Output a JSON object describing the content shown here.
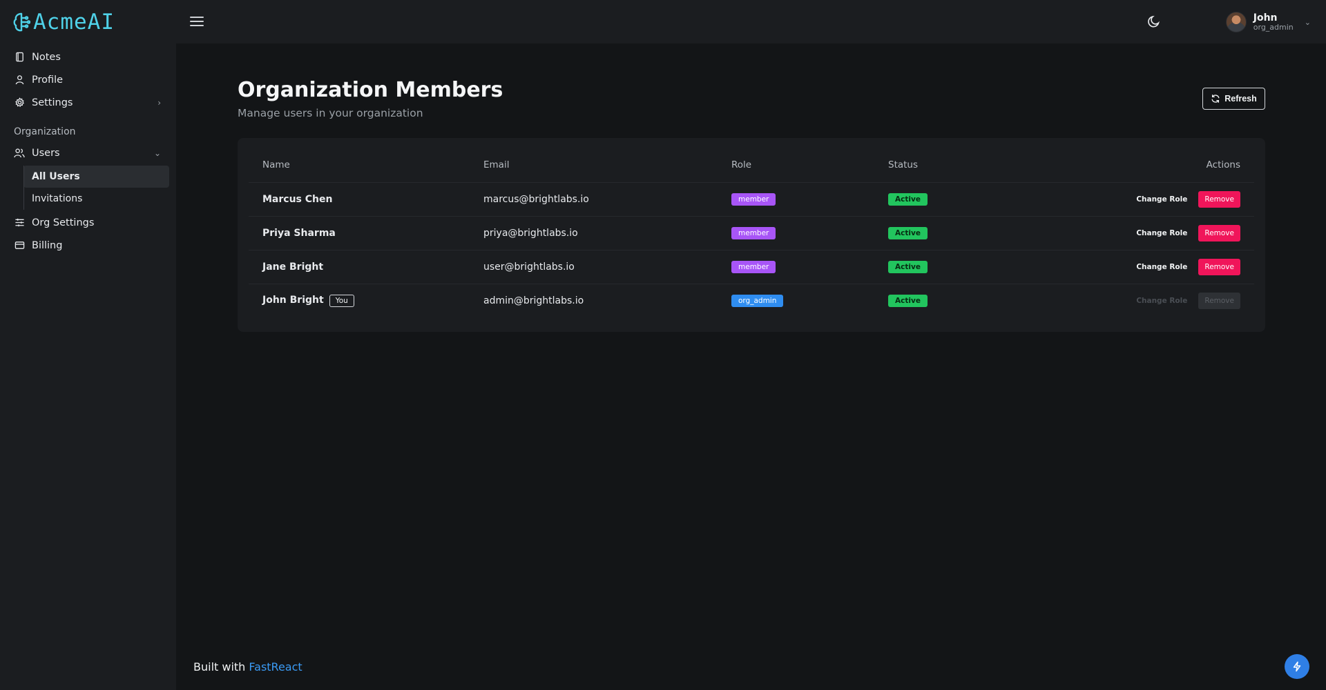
{
  "app": {
    "logo_text": "AcmeAI",
    "brand_color": "#4fd1e8"
  },
  "sidebar": {
    "items": [
      {
        "label": "Notes",
        "icon": "notebook-icon"
      },
      {
        "label": "Profile",
        "icon": "user-icon"
      },
      {
        "label": "Settings",
        "icon": "gear-icon"
      }
    ],
    "section_label": "Organization",
    "users": {
      "label": "Users",
      "sub_items": [
        {
          "label": "All Users",
          "active": true
        },
        {
          "label": "Invitations",
          "active": false
        }
      ]
    },
    "org_items": [
      {
        "label": "Org Settings",
        "icon": "sliders-icon"
      },
      {
        "label": "Billing",
        "icon": "credit-card-icon"
      }
    ]
  },
  "topbar": {
    "user": {
      "name": "John",
      "role": "org_admin"
    }
  },
  "main": {
    "title": "Organization Members",
    "subtitle": "Manage users in your organization",
    "refresh_label": "Refresh",
    "table": {
      "headers": {
        "name": "Name",
        "email": "Email",
        "role": "Role",
        "status": "Status",
        "actions": "Actions"
      },
      "rows": [
        {
          "name": "Marcus Chen",
          "email": "marcus@brightlabs.io",
          "role": "member",
          "status": "Active",
          "change_role": "Change Role",
          "remove": "Remove"
        },
        {
          "name": "Priya Sharma",
          "email": "priya@brightlabs.io",
          "role": "member",
          "status": "Active",
          "change_role": "Change Role",
          "remove": "Remove"
        },
        {
          "name": "Jane Bright",
          "email": "user@brightlabs.io",
          "role": "member",
          "status": "Active",
          "change_role": "Change Role",
          "remove": "Remove"
        },
        {
          "name": "John Bright",
          "you_badge": "You",
          "email": "admin@brightlabs.io",
          "role": "org_admin",
          "status": "Active",
          "change_role": "Change Role",
          "remove": "Remove"
        }
      ]
    }
  },
  "footer": {
    "prefix": "Built with",
    "link_text": "FastReact"
  },
  "colors": {
    "member_badge": "#a855f7",
    "admin_badge": "#2f8df0",
    "active_badge": "#22c55e",
    "remove_button": "#f0155a",
    "link": "#3b9bf5"
  }
}
